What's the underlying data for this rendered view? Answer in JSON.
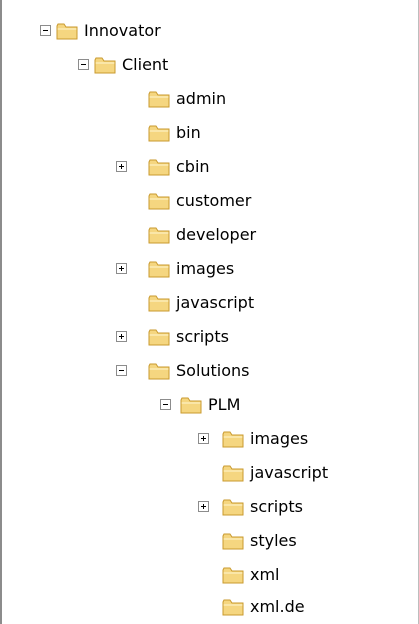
{
  "tree": {
    "items": [
      {
        "label": "Innovator",
        "toggle": "minus"
      },
      {
        "label": "Client",
        "toggle": "minus"
      },
      {
        "label": "admin",
        "toggle": "none"
      },
      {
        "label": "bin",
        "toggle": "none"
      },
      {
        "label": "cbin",
        "toggle": "plus"
      },
      {
        "label": "customer",
        "toggle": "none"
      },
      {
        "label": "developer",
        "toggle": "none"
      },
      {
        "label": "images",
        "toggle": "plus"
      },
      {
        "label": "javascript",
        "toggle": "none"
      },
      {
        "label": "scripts",
        "toggle": "plus"
      },
      {
        "label": "Solutions",
        "toggle": "minus"
      },
      {
        "label": "PLM",
        "toggle": "minus"
      },
      {
        "label": "images",
        "toggle": "plus"
      },
      {
        "label": "javascript",
        "toggle": "none"
      },
      {
        "label": "scripts",
        "toggle": "plus"
      },
      {
        "label": "styles",
        "toggle": "none"
      },
      {
        "label": "xml",
        "toggle": "none"
      },
      {
        "label": "xml.de",
        "toggle": "none"
      }
    ]
  },
  "colors": {
    "folder_fill": "#f5d680",
    "folder_stroke": "#c99a2e",
    "folder_light": "#fbecb6"
  }
}
